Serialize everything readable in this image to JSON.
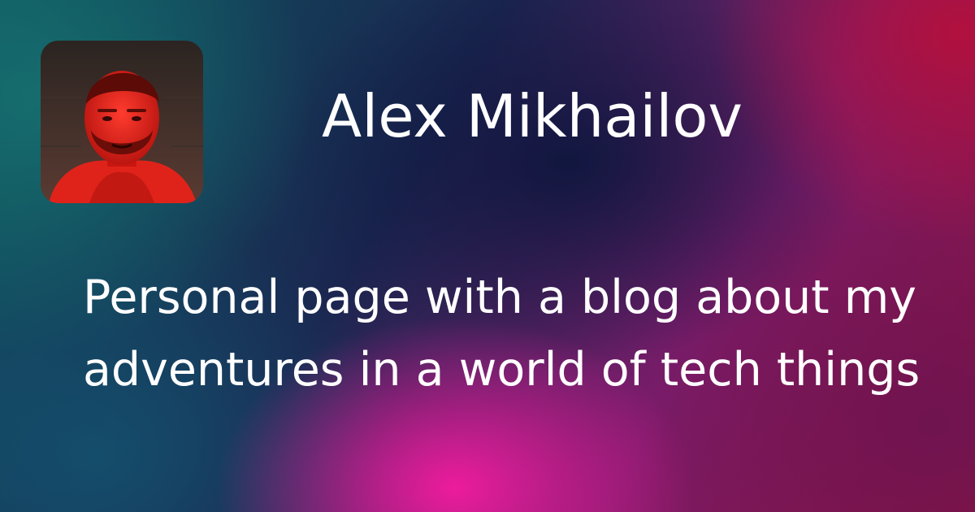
{
  "profile": {
    "name": "Alex Mikhailov",
    "tagline": "Personal page with a blog about my adventures in a world of tech things"
  },
  "colors": {
    "text": "#ffffff",
    "teal": "#0d5660",
    "navy": "#1b2650",
    "magenta": "#f51ca0",
    "crimson": "#b4103c"
  }
}
